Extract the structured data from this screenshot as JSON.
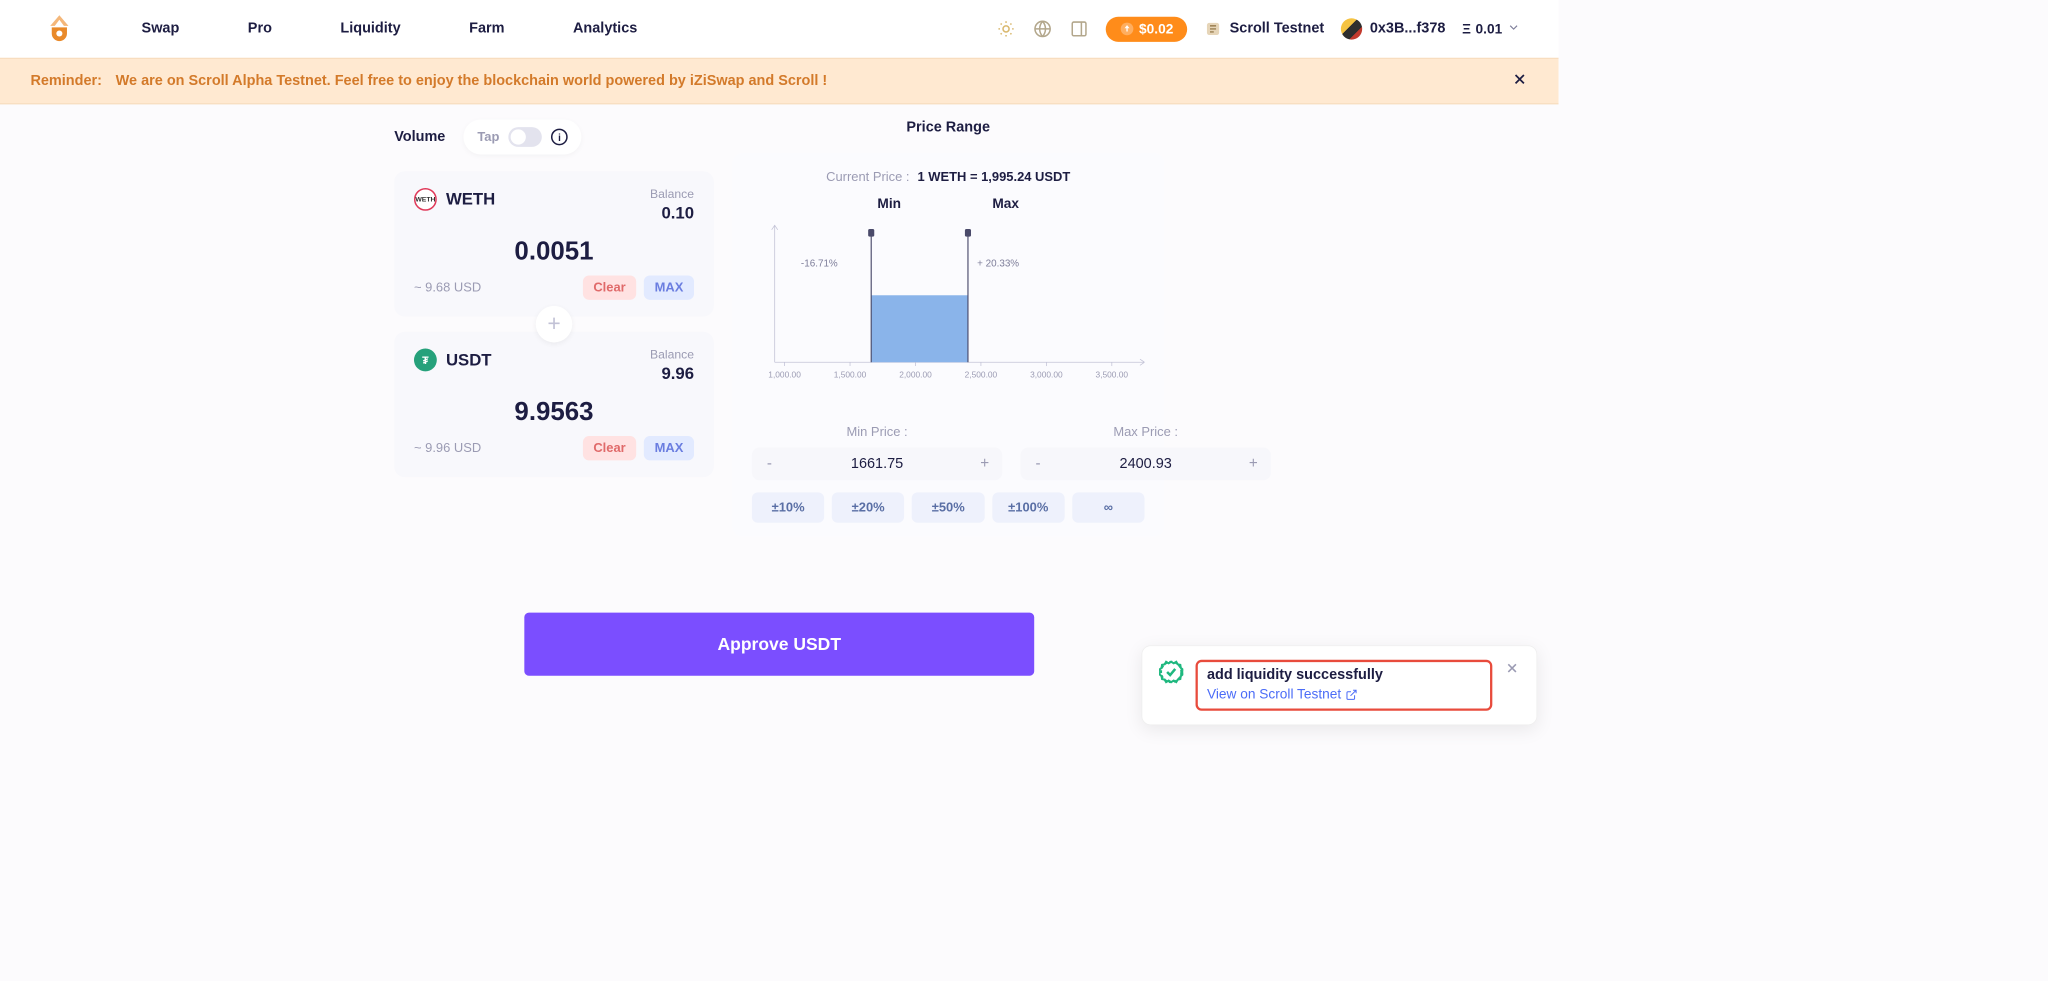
{
  "header": {
    "nav": {
      "swap": "Swap",
      "pro": "Pro",
      "liquidity": "Liquidity",
      "farm": "Farm",
      "analytics": "Analytics"
    },
    "pill_price": "$0.02",
    "network": "Scroll Testnet",
    "wallet_addr": "0x3B...f378",
    "eth_balance": "0.01"
  },
  "banner": {
    "label": "Reminder:",
    "text": "We are on Scroll Alpha Testnet. Feel free to enjoy the blockchain world powered by iZiSwap and Scroll !"
  },
  "volume": {
    "label": "Volume",
    "tap": "Tap"
  },
  "tokens": {
    "a": {
      "symbol": "WETH",
      "balance_label": "Balance",
      "balance": "0.10",
      "amount": "0.0051",
      "usd": "~ 9.68 USD",
      "clear": "Clear",
      "max": "MAX"
    },
    "b": {
      "symbol": "USDT",
      "balance_label": "Balance",
      "balance": "9.96",
      "amount": "9.9563",
      "usd": "~ 9.96 USD",
      "clear": "Clear",
      "max": "MAX"
    }
  },
  "price_range": {
    "title": "Price Range",
    "current_label": "Current Price :",
    "current_val": "1 WETH = 1,995.24 USDT",
    "min_label": "Min",
    "max_label": "Max",
    "min_pct": "-16.71%",
    "max_pct": "+ 20.33%",
    "min_price_label": "Min Price :",
    "max_price_label": "Max Price :",
    "min_price": "1661.75",
    "max_price": "2400.93",
    "ticks": [
      "1,000.00",
      "1,500.00",
      "2,000.00",
      "2,500.00",
      "3,000.00",
      "3,500.00"
    ],
    "pct_buttons": [
      "±10%",
      "±20%",
      "±50%",
      "±100%",
      "∞"
    ]
  },
  "approve": "Approve USDT",
  "toast": {
    "title": "add liquidity successfully",
    "link": "View on Scroll Testnet"
  },
  "chart_data": {
    "type": "bar",
    "x_range": [
      750,
      3750
    ],
    "y_range": [
      0,
      1
    ],
    "selected_range": {
      "min": 1661.75,
      "max": 2400.93,
      "height": 0.55
    },
    "ticks": [
      1000,
      1500,
      2000,
      2500,
      3000,
      3500
    ],
    "annotations": {
      "min_line_pct": "-16.71%",
      "max_line_pct": "+ 20.33%",
      "min_label": "Min",
      "max_label": "Max"
    }
  }
}
